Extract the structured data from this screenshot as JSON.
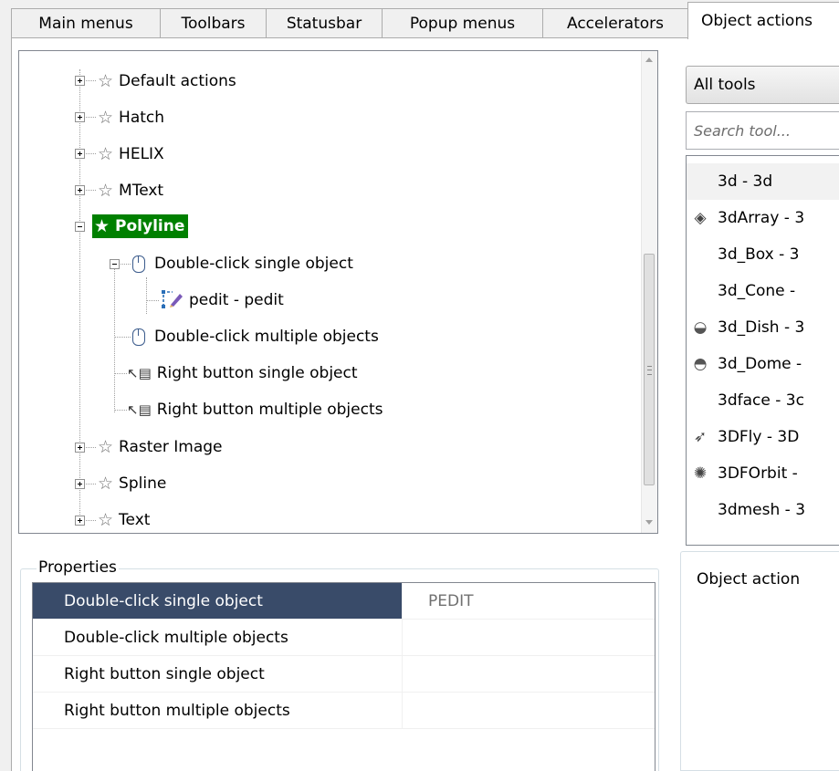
{
  "tabs": [
    {
      "label": "Main menus"
    },
    {
      "label": "Toolbars"
    },
    {
      "label": "Statusbar"
    },
    {
      "label": "Popup menus"
    },
    {
      "label": "Accelerators"
    },
    {
      "label": "Object actions"
    }
  ],
  "tree": {
    "items": [
      {
        "label": "Default actions"
      },
      {
        "label": "Hatch"
      },
      {
        "label": "HELIX"
      },
      {
        "label": "MText"
      },
      {
        "label": "Polyline"
      },
      {
        "label": "Double-click single object"
      },
      {
        "label": "pedit - pedit"
      },
      {
        "label": "Double-click multiple objects"
      },
      {
        "label": "Right button single object"
      },
      {
        "label": "Right button multiple objects"
      },
      {
        "label": "Raster Image"
      },
      {
        "label": "Spline"
      },
      {
        "label": "Text"
      }
    ]
  },
  "tools": {
    "filter": "All tools",
    "search_placeholder": "Search tool...",
    "items": [
      {
        "label": "3d - 3d",
        "icon": "none"
      },
      {
        "label": "3dArray - 3",
        "icon": "array-icon"
      },
      {
        "label": "3d_Box - 3",
        "icon": "none"
      },
      {
        "label": "3d_Cone -",
        "icon": "none"
      },
      {
        "label": "3d_Dish - 3",
        "icon": "dish-icon"
      },
      {
        "label": "3d_Dome -",
        "icon": "dome-icon"
      },
      {
        "label": "3dface - 3c",
        "icon": "none"
      },
      {
        "label": "3DFly - 3D",
        "icon": "paper-plane-icon"
      },
      {
        "label": "3DFOrbit -",
        "icon": "orbit-icon"
      },
      {
        "label": "3dmesh - 3",
        "icon": "none"
      }
    ]
  },
  "object_action_label": "Object action",
  "properties": {
    "title": "Properties",
    "rows": [
      {
        "name": "Double-click single object",
        "value": "PEDIT"
      },
      {
        "name": "Double-click multiple objects",
        "value": ""
      },
      {
        "name": "Right button single object",
        "value": ""
      },
      {
        "name": "Right button multiple objects",
        "value": ""
      }
    ]
  },
  "colors": {
    "selected_node": "#008000",
    "selected_row": "#394b69"
  }
}
